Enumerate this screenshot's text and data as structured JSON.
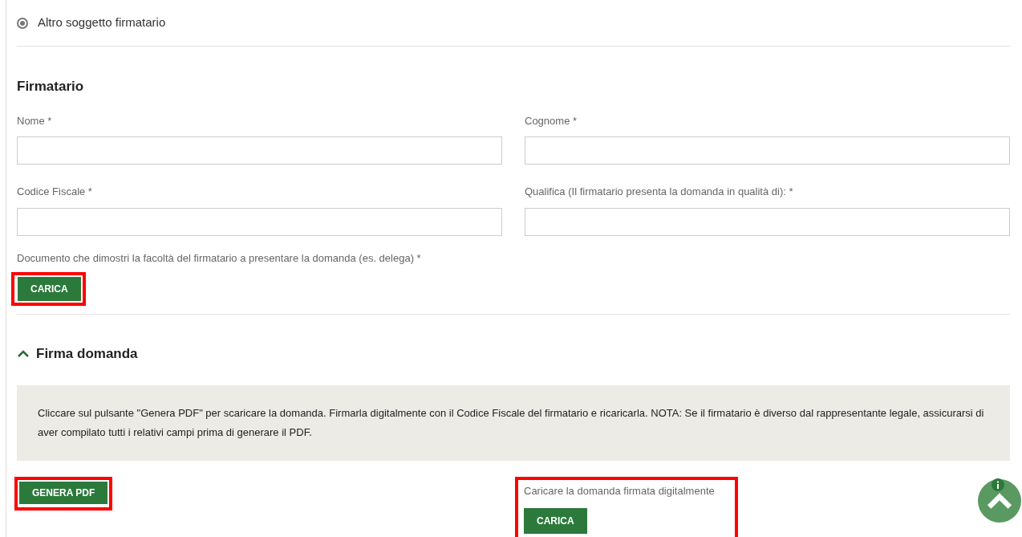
{
  "radio": {
    "label": "Altro soggetto firmatario",
    "selected": true
  },
  "firmatario": {
    "title": "Firmatario",
    "fields": [
      {
        "label": "Nome *"
      },
      {
        "label": "Cognome *"
      },
      {
        "label": "Codice Fiscale *"
      },
      {
        "label": "Qualifica (Il firmatario presenta la domanda in qualità di): *"
      }
    ],
    "document_label": "Documento che dimostri la facoltà del firmatario a presentare la domanda (es. delega) *",
    "upload_button": "CARICA"
  },
  "firma_domanda": {
    "title": "Firma domanda",
    "expanded": true,
    "note": "Cliccare sul pulsante \"Genera PDF\" per scaricare la domanda. Firmarla digitalmente con il Codice Fiscale del firmatario e ricaricarla. NOTA: Se il firmatario è diverso dal rappresentante legale, assicurarsi di aver compilato tutti i relativi campi prima di generare il PDF.",
    "generate_button": "GENERA PDF",
    "upload_label": "Caricare la domanda firmata digitalmente",
    "upload_button": "CARICA"
  }
}
